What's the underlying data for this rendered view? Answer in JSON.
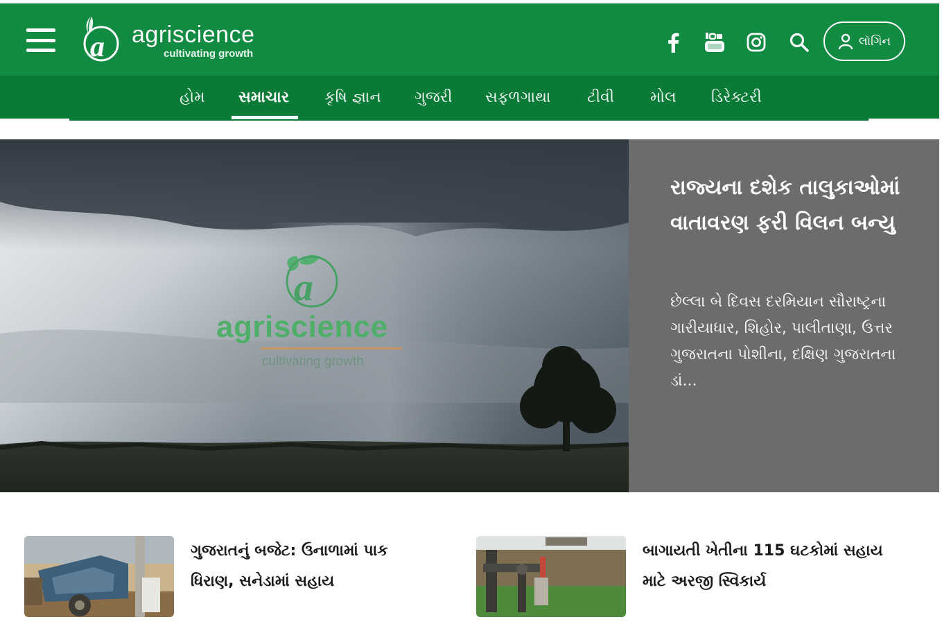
{
  "colors": {
    "brand_green": "#118a42",
    "nav_green": "#0a7a37",
    "hero_panel_gray": "#6c6c6c"
  },
  "header": {
    "menu_icon": "hamburger-menu-icon",
    "logo": {
      "name": "agriscience",
      "tagline": "cultivating growth"
    },
    "social_icons": [
      "facebook-icon",
      "youtube-icon",
      "instagram-icon"
    ],
    "search_icon": "search-icon",
    "login_label": "લૉગિન"
  },
  "nav": {
    "items": [
      {
        "label": "હોમ"
      },
      {
        "label": "સમાચાર",
        "active": true
      },
      {
        "label": "કૃષિ જ્ઞાન"
      },
      {
        "label": "ગુજરી"
      },
      {
        "label": "સફળગાથા"
      },
      {
        "label": "ટીવી"
      },
      {
        "label": "મોલ"
      },
      {
        "label": "ડિરેક્ટરી"
      }
    ]
  },
  "hero": {
    "watermark": "agriscience",
    "watermark_tagline": "cultivating growth",
    "title": "રાજ્યના દશેક તાલુકાઓમાં વાતાવરણ ફરી વિલન બન્યુ",
    "description": "છેલ્લા બે દિવસ દરમિયાન સૌરાષ્ટ્રના ગારીયાધાર, શિહોર, પાલીતાણા, ઉત્તર ગુજરાતના પોશીના, દક્ષિણ ગુજરાતના ડાં..."
  },
  "articles": [
    {
      "title": "ગુજરાતનું બજેટ: ઉનાળામાં પાક ધિરાણ, સનેડામાં સહાય"
    },
    {
      "title": "બાગાયતી ખેતીના 115 ઘટકોમાં સહાય માટે અરજી સ્વિકાર્ય"
    }
  ]
}
